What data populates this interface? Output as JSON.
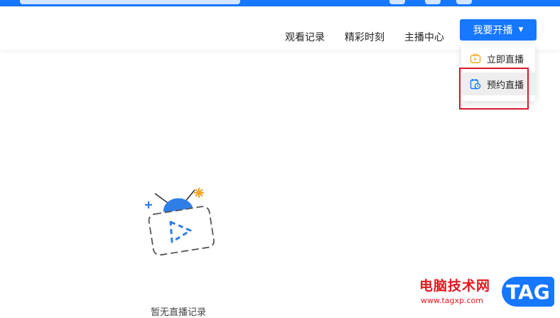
{
  "header": {
    "nav": [
      "观看记录",
      "精彩时刻",
      "主播中心"
    ],
    "broadcast_button": "我要开播"
  },
  "dropdown": {
    "items": [
      {
        "label": "立即直播",
        "icon": "tv-icon"
      },
      {
        "label": "预约直播",
        "icon": "calendar-clock-icon"
      }
    ]
  },
  "empty_state": {
    "text": "暂无直播记录",
    "icon": "tv-play-icon"
  },
  "watermark": {
    "site": "电脑技术网",
    "url": "www.tagxp.com",
    "badge": "TAG"
  },
  "colors": {
    "accent": "#1677ff",
    "highlight": "#d8172a",
    "watermark_red": "#e5161e",
    "icon_orange": "#f5a623"
  }
}
